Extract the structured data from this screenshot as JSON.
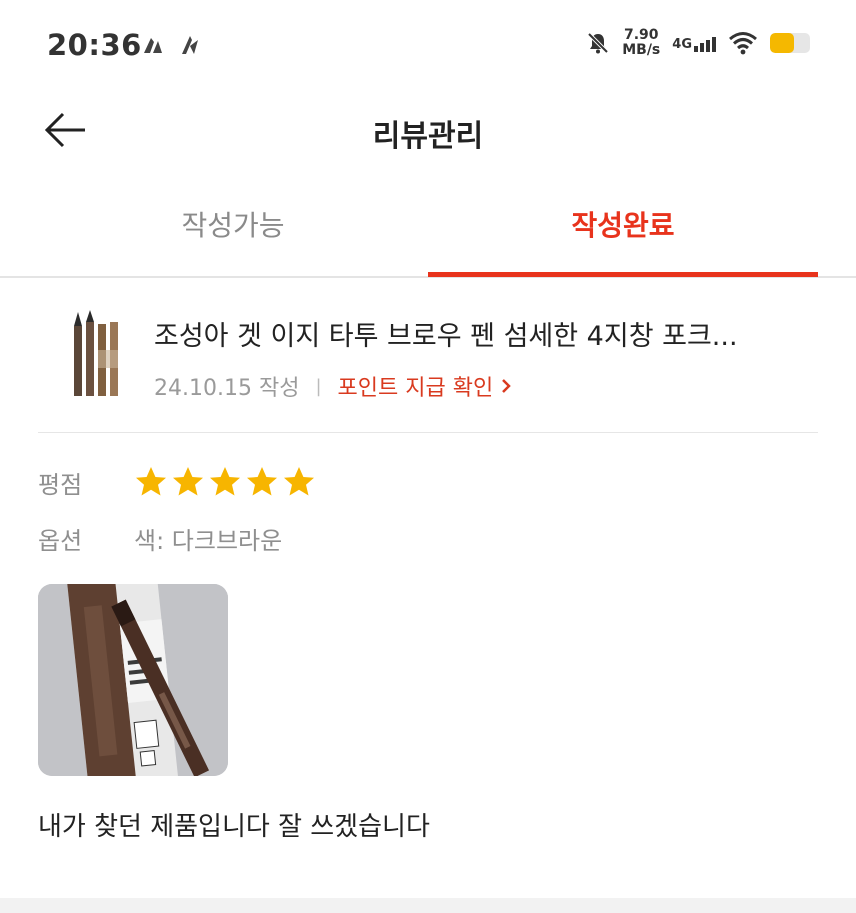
{
  "status_bar": {
    "time": "20:36",
    "speed_value": "7.90",
    "speed_unit": "MB/s",
    "network": "4G",
    "battery_level": 0.6,
    "battery_color": "#f5b800"
  },
  "header": {
    "title": "리뷰관리",
    "back_icon": "arrow-left-icon"
  },
  "tabs": [
    {
      "label": "작성가능",
      "active": false
    },
    {
      "label": "작성완료",
      "active": true
    }
  ],
  "product": {
    "name": "조성아 겟 이지 타투 브로우 펜 섬세한 4지창 포크...",
    "date": "24.10.15 작성",
    "separator": "|",
    "point_link": "포인트 지급 확인"
  },
  "review": {
    "rating_label": "평점",
    "rating": 5,
    "rating_max": 5,
    "option_label": "옵션",
    "option_value": "색: 다크브라운",
    "text": "내가 찾던 제품입니다 잘 쓰겠습니다"
  },
  "colors": {
    "accent": "#e8331c",
    "star": "#f7b500"
  }
}
